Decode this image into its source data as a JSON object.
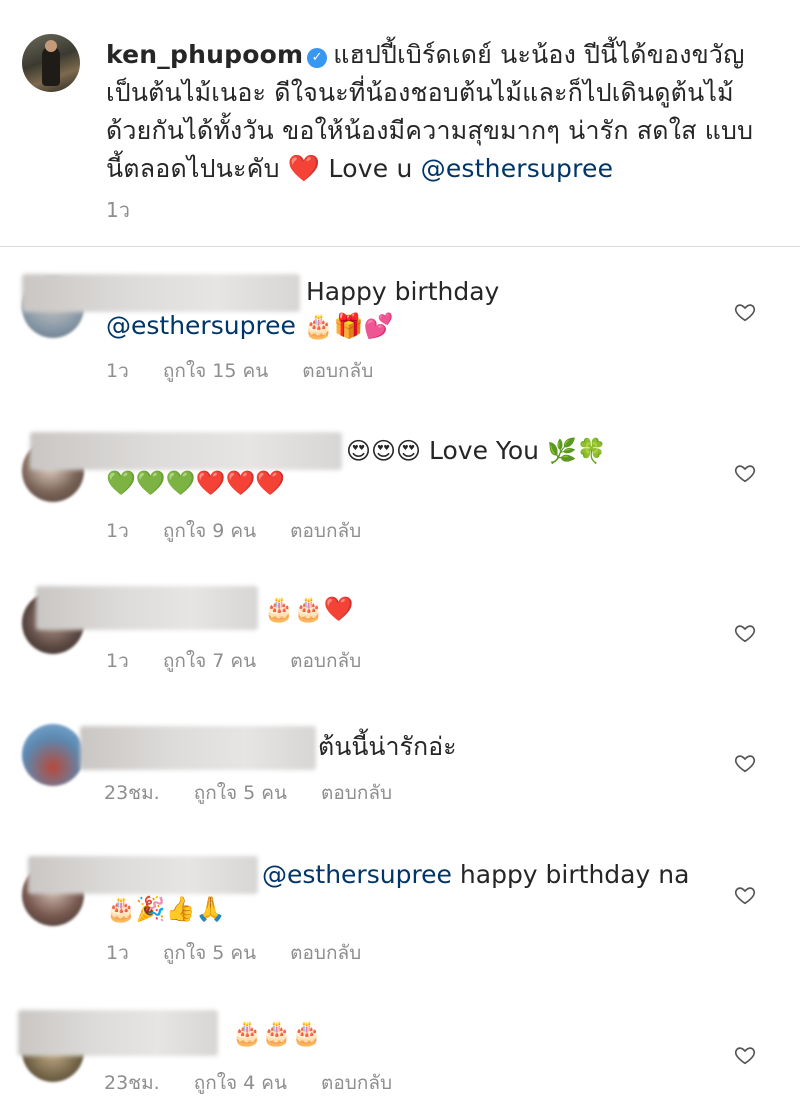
{
  "post": {
    "username": "ken_phupoom",
    "verified_icon": "verified-badge-icon",
    "caption_line1": "แฮปปี้เบิร์ดเดย์ นะน้อง ปีนี้ได้ของขวัญ",
    "caption_line2": "เป็นต้นไม้เนอะ ดีใจนะที่น้องชอบต้นไม้และก็ไปเดินดูต้นไม้",
    "caption_line3": "ด้วยกันได้ทั้งวัน ขอให้น้องมีความสุขมากๆ น่ารัก สดใส แบบ",
    "caption_line4": "นี้ตลอดไปนะคับ",
    "caption_heart": "❤️",
    "caption_love": "Love u",
    "caption_mention": "@esthersupree",
    "time": "1ว"
  },
  "comments": [
    {
      "text": "Happy birthday",
      "mention": "@esthersupree",
      "emojis": "🎂🎁💕",
      "time": "1ว",
      "likes": "ถูกใจ 15 คน",
      "reply": "ตอบกลับ"
    },
    {
      "emojis_a": "😍😍😍",
      "text": "Love You",
      "emojis_b": "🌿🍀",
      "hearts_green": "💚💚💚",
      "hearts_red": "❤️❤️❤️",
      "time": "1ว",
      "likes": "ถูกใจ 9 คน",
      "reply": "ตอบกลับ"
    },
    {
      "emojis": "🎂🎂❤️",
      "time": "1ว",
      "likes": "ถูกใจ 7 คน",
      "reply": "ตอบกลับ"
    },
    {
      "text": "ต้นนี้น่ารักอ่ะ",
      "time": "23ชม.",
      "likes": "ถูกใจ 5 คน",
      "reply": "ตอบกลับ"
    },
    {
      "mention": "@esthersupree",
      "text": "happy birthday na",
      "emojis": "🎂🎉👍🙏",
      "time": "1ว",
      "likes": "ถูกใจ 5 คน",
      "reply": "ตอบกลับ"
    },
    {
      "emojis": "🎂🎂🎂",
      "time": "23ชม.",
      "likes": "ถูกใจ 4 คน",
      "reply": "ตอบกลับ"
    }
  ],
  "icons": {
    "like": "heart-outline-icon"
  },
  "colors": {
    "mention": "#003569",
    "meta": "#8e8e8e",
    "verified": "#3897f0"
  }
}
